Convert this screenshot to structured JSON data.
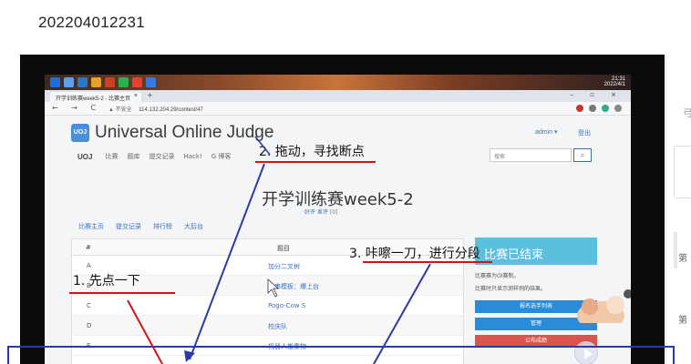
{
  "caption": "202204012231",
  "browser": {
    "tab_title": "开学训练赛week5-2 - 比赛主页",
    "tab_close": "×",
    "tab_new": "+",
    "window_controls": "– ▫ ×",
    "nav_buttons": "← → C",
    "security": "▲ 不安全",
    "url": "114.132.204.29/contest/47",
    "tray_time": "21:31",
    "tray_date": "2022/4/1"
  },
  "oj": {
    "logo": "UOJ",
    "title": "Universal Online Judge",
    "admin": "admin ▾",
    "logout": "登出",
    "nav": [
      "UOJ",
      "比赛",
      "题库",
      "提交记录",
      "Hack!",
      "G 博客"
    ],
    "search_placeholder": "搜索",
    "contest_title": "开学训练赛week5-2",
    "rating": "好评",
    "bad": "差评",
    "rating_count": "[0]",
    "subnav": [
      "比赛主页",
      "提交记录",
      "排行榜",
      "大后台"
    ],
    "table_head": [
      "#",
      "题目"
    ],
    "problems": [
      {
        "label": "A",
        "name": "加分二叉树"
      },
      {
        "label": "B",
        "name": "串串模板：爆上台"
      },
      {
        "label": "C",
        "name": "Pogo-Cow S"
      },
      {
        "label": "D",
        "name": "校庆队"
      },
      {
        "label": "E",
        "name": "机器人搬重物"
      }
    ],
    "panel": {
      "status": "比赛已结束",
      "line1": "比赛赛为OI赛制。",
      "line2": "比赛时只显示测样例的结果。",
      "btn1": "报名选手列表",
      "btn2": "管理",
      "btn3": "公布成绩"
    }
  },
  "annotations": {
    "step1": "1. 先点一下",
    "step2": "2. 拖动，寻找断点",
    "step3": "3. 咔嚓一刀，进行分段"
  },
  "right_sidebar": {
    "t1": "弓",
    "t2": "第",
    "t3": "第"
  },
  "colors": {
    "annotation_red": "#d0141a",
    "arrow_blue": "#2a3ba8",
    "accent_blue": "#5bc0de"
  }
}
